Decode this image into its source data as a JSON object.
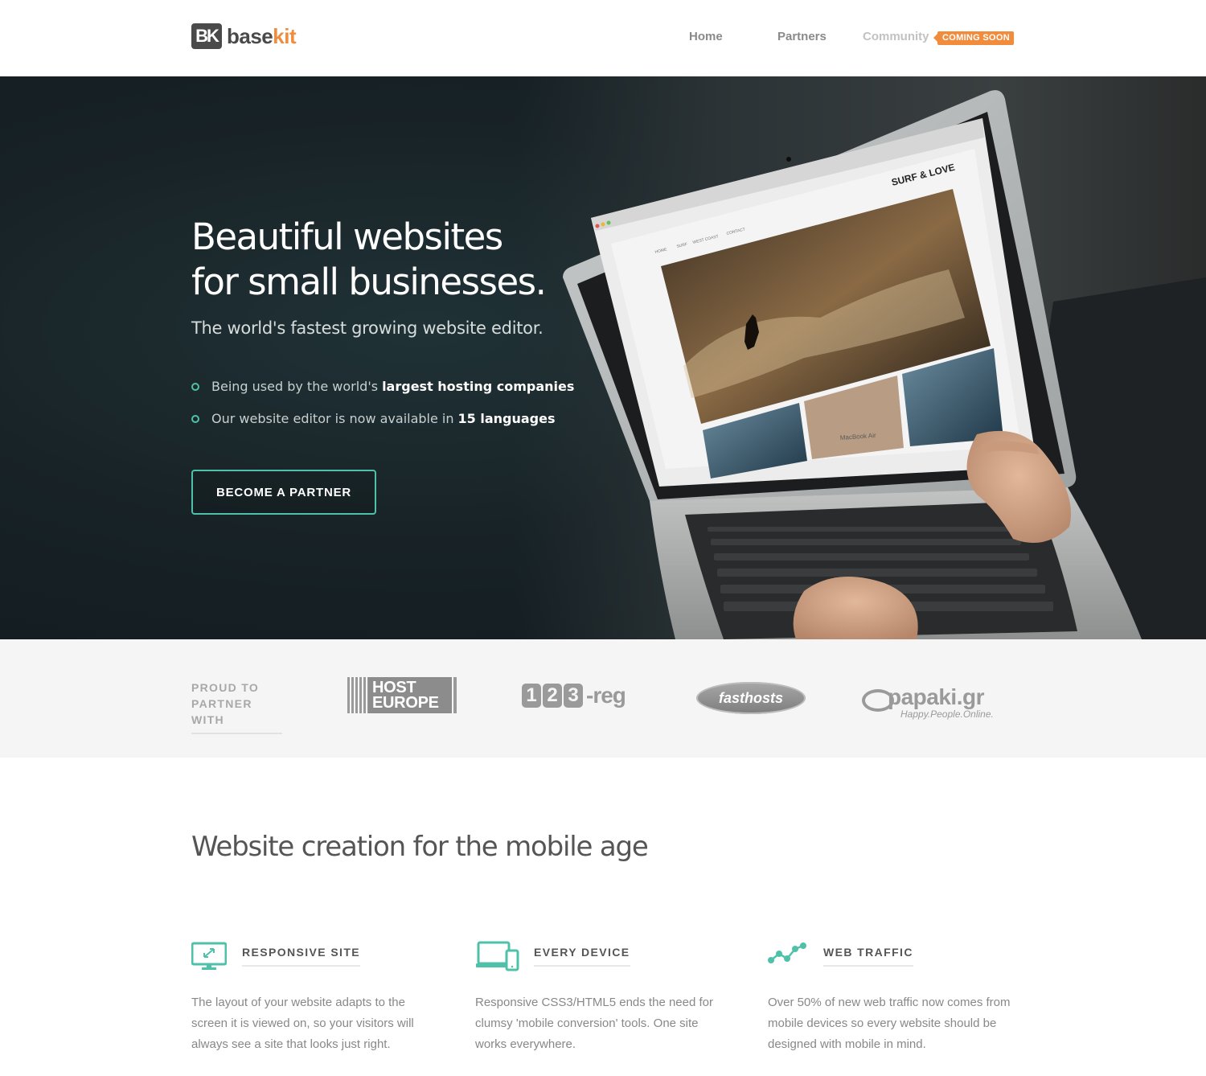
{
  "header": {
    "logo": {
      "mark": "BK",
      "text_a": "base",
      "text_b": "kit"
    },
    "nav": [
      {
        "label": "Home"
      },
      {
        "label": "Partners"
      },
      {
        "label": "Community"
      }
    ],
    "badge": "COMING SOON"
  },
  "hero": {
    "title_line1": "Beautiful websites",
    "title_line2": "for small businesses.",
    "subtitle": "The world's fastest growing website editor.",
    "bullets": [
      {
        "text": "Being used by the world's",
        "emphasis": "largest hosting companies"
      },
      {
        "text": "Our website editor is now available in",
        "emphasis": "15 languages"
      }
    ],
    "cta": "BECOME A PARTNER",
    "screen": {
      "brand": "SURF & LOVE",
      "nav": [
        "HOME",
        "SURF",
        "WEST COAST",
        "CONTACT"
      ],
      "laptop_label": "MacBook Air"
    }
  },
  "partners": {
    "label_line1": "PROUD TO",
    "label_line2": "PARTNER WITH",
    "logos": [
      {
        "name": "HOST EUROPE",
        "line1": "HOST",
        "line2": "EUROPE"
      },
      {
        "name": "123-reg",
        "digits": [
          "1",
          "2",
          "3"
        ],
        "suffix": "-reg"
      },
      {
        "name": "fasthosts",
        "text": "fasthosts"
      },
      {
        "name": "papaki.gr",
        "text": "papaki.gr",
        "tagline": "Happy.People.Online."
      }
    ]
  },
  "features": {
    "title": "Website creation for the mobile age",
    "items": [
      {
        "icon": "responsive-monitor-icon",
        "label": "RESPONSIVE SITE",
        "lines": [
          "The layout of your website adapts to the",
          "screen it is viewed on, so your visitors will",
          "always see a site that looks just right."
        ]
      },
      {
        "icon": "devices-icon",
        "label": "EVERY DEVICE",
        "lines": [
          "Responsive CSS3/HTML5 ends the need for",
          "clumsy 'mobile conversion' tools. One site",
          "works everywhere."
        ]
      },
      {
        "icon": "traffic-graph-icon",
        "label": "WEB TRAFFIC",
        "lines": [
          "Over 50% of new web traffic now comes from",
          "mobile devices so every website should be",
          "designed with mobile in mind."
        ]
      }
    ]
  },
  "colors": {
    "accent": "#4fc1a8",
    "brand_orange": "#f08c3c",
    "dark": "#4a4a4a",
    "hero_bg": "#182327"
  }
}
